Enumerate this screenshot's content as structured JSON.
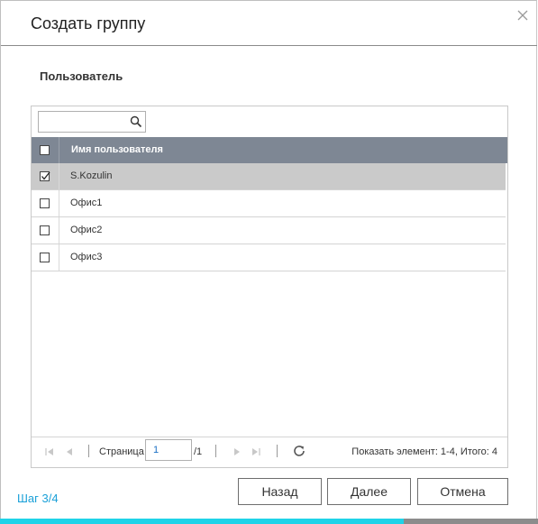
{
  "dialog": {
    "title": "Создать группу",
    "close_icon": "close-icon"
  },
  "section": {
    "label": "Пользователь"
  },
  "search": {
    "value": "",
    "placeholder": "",
    "icon": "search-icon"
  },
  "grid": {
    "header": {
      "select_all_checked": false,
      "column_label": "Имя пользователя"
    },
    "rows": [
      {
        "name": "S.Kozulin",
        "checked": true,
        "selected": true
      },
      {
        "name": "Офис1",
        "checked": false,
        "selected": false
      },
      {
        "name": "Офис2",
        "checked": false,
        "selected": false
      },
      {
        "name": "Офис3",
        "checked": false,
        "selected": false
      }
    ]
  },
  "pager": {
    "page_label": "Страница",
    "page_value": "1",
    "page_total": "/1",
    "display_info": "Показать элемент: 1-4, Итого: 4",
    "icons": [
      "first-page-icon",
      "prev-page-icon",
      "next-page-icon",
      "last-page-icon",
      "refresh-icon"
    ]
  },
  "footer": {
    "step": "Шаг 3/4",
    "back_label": "Назад",
    "next_label": "Далее",
    "cancel_label": "Отмена"
  },
  "progress": {
    "fraction": 0.75,
    "fill_color": "#1fd3e8",
    "track_color": "#8c8c8c"
  },
  "colors": {
    "header_bg": "#7e8794",
    "selected_row_bg": "#cacaca",
    "step_text": "#1aa0d8"
  }
}
